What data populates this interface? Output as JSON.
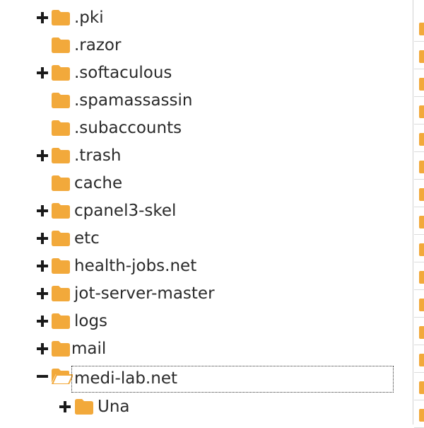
{
  "colors": {
    "folder": "#f2a93b",
    "text": "#2a2a2a",
    "toggle": "#1a1a1a"
  },
  "tree": {
    "items": [
      {
        "label": ".pki",
        "toggle": "plus",
        "open": false
      },
      {
        "label": ".razor",
        "toggle": "none",
        "open": false
      },
      {
        "label": ".softaculous",
        "toggle": "plus",
        "open": false
      },
      {
        "label": ".spamassassin",
        "toggle": "none",
        "open": false
      },
      {
        "label": ".subaccounts",
        "toggle": "none",
        "open": false
      },
      {
        "label": ".trash",
        "toggle": "plus",
        "open": false
      },
      {
        "label": "cache",
        "toggle": "none",
        "open": false
      },
      {
        "label": "cpanel3-skel",
        "toggle": "plus",
        "open": false
      },
      {
        "label": "etc",
        "toggle": "plus",
        "open": false
      },
      {
        "label": "health-jobs.net",
        "toggle": "plus",
        "open": false
      },
      {
        "label": "jot-server-master",
        "toggle": "plus",
        "open": false
      },
      {
        "label": "logs",
        "toggle": "plus",
        "open": false
      },
      {
        "label": "mail",
        "toggle": "plus",
        "open": false
      },
      {
        "label": "medi-lab.net",
        "toggle": "minus",
        "open": true,
        "selected": true
      },
      {
        "label": "Una",
        "toggle": "plus",
        "open": false,
        "child": true
      }
    ]
  }
}
